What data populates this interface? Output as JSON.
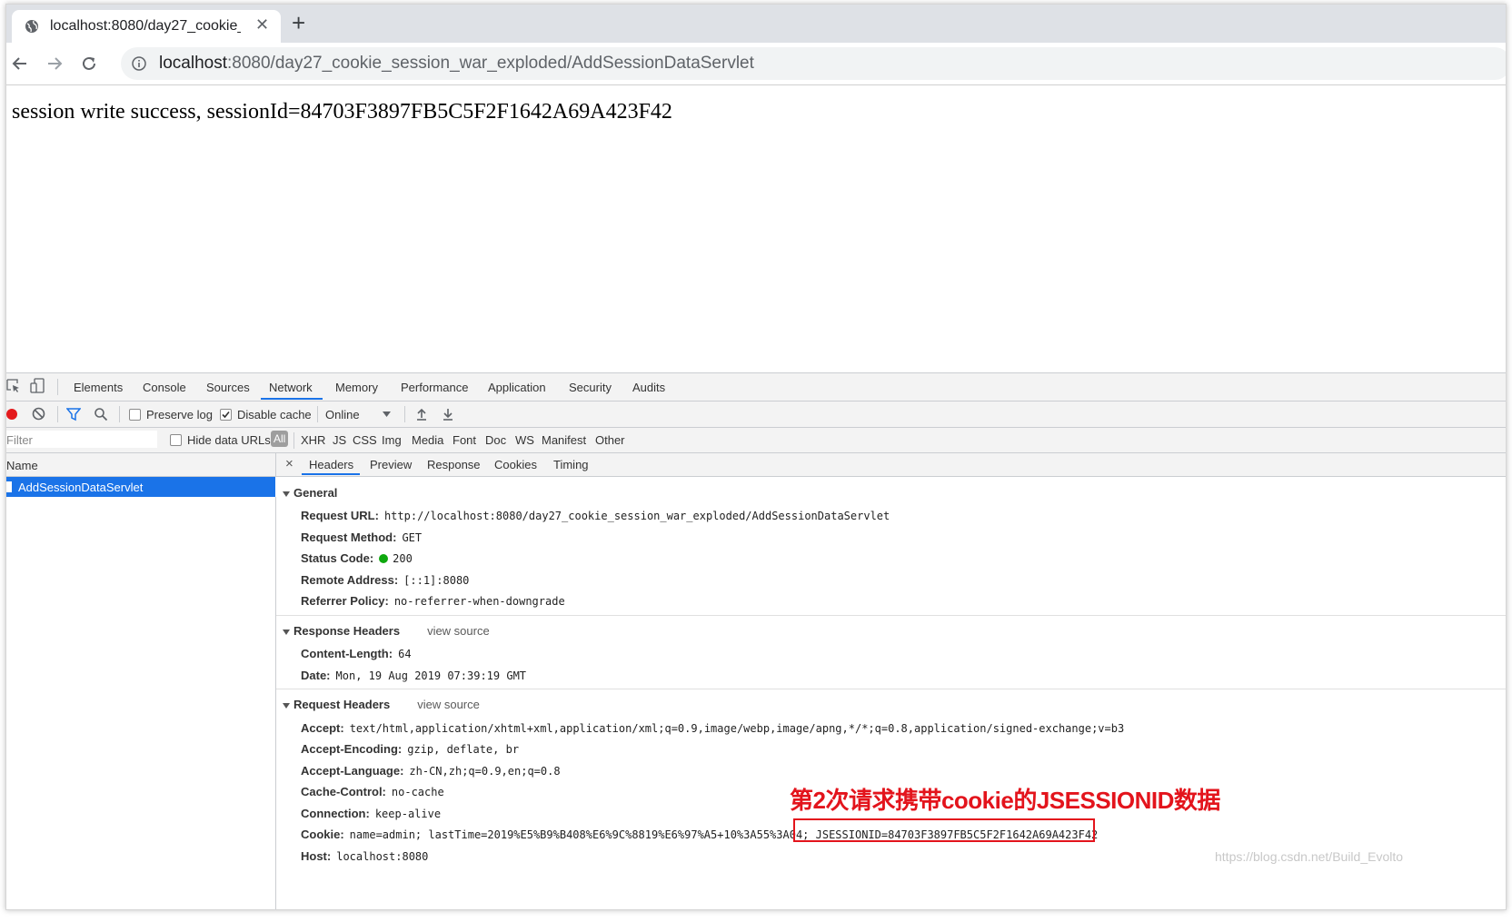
{
  "browser": {
    "tab_title": "localhost:8080/day27_cookie_s",
    "tab_close": "✕",
    "new_tab": "+",
    "url_host": "localhost",
    "url_rest": ":8080/day27_cookie_session_war_exploded/AddSessionDataServlet"
  },
  "page": {
    "message": "session write success, sessionId=84703F3897FB5C5F2F1642A69A423F42"
  },
  "devtools": {
    "tabs": [
      "Elements",
      "Console",
      "Sources",
      "Network",
      "Memory",
      "Performance",
      "Application",
      "Security",
      "Audits"
    ],
    "active_tab": "Network",
    "toolbar": {
      "preserve_log": "Preserve log",
      "disable_cache": "Disable cache",
      "disable_cache_checked": true,
      "throttle": "Online"
    },
    "filter": {
      "placeholder": "Filter",
      "hide_data_urls": "Hide data URLs",
      "types": [
        "All",
        "XHR",
        "JS",
        "CSS",
        "Img",
        "Media",
        "Font",
        "Doc",
        "WS",
        "Manifest",
        "Other"
      ]
    },
    "name_header": "Name",
    "request_name": "AddSessionDataServlet",
    "close_glyph": "×",
    "detail_tabs": [
      "Headers",
      "Preview",
      "Response",
      "Cookies",
      "Timing"
    ],
    "general": {
      "title": "General",
      "rows": [
        {
          "k": "Request URL:",
          "v": "http://localhost:8080/day27_cookie_session_war_exploded/AddSessionDataServlet"
        },
        {
          "k": "Request Method:",
          "v": "GET"
        },
        {
          "k": "Status Code:",
          "v": "200"
        },
        {
          "k": "Remote Address:",
          "v": "[::1]:8080"
        },
        {
          "k": "Referrer Policy:",
          "v": "no-referrer-when-downgrade"
        }
      ]
    },
    "response_headers": {
      "title": "Response Headers",
      "view_source": "view source",
      "rows": [
        {
          "k": "Content-Length:",
          "v": "64"
        },
        {
          "k": "Date:",
          "v": "Mon, 19 Aug 2019 07:39:19 GMT"
        }
      ]
    },
    "request_headers": {
      "title": "Request Headers",
      "view_source": "view source",
      "rows": [
        {
          "k": "Accept:",
          "v": "text/html,application/xhtml+xml,application/xml;q=0.9,image/webp,image/apng,*/*;q=0.8,application/signed-exchange;v=b3"
        },
        {
          "k": "Accept-Encoding:",
          "v": "gzip, deflate, br"
        },
        {
          "k": "Accept-Language:",
          "v": "zh-CN,zh;q=0.9,en;q=0.8"
        },
        {
          "k": "Cache-Control:",
          "v": "no-cache"
        },
        {
          "k": "Connection:",
          "v": "keep-alive"
        },
        {
          "k": "Cookie:",
          "v": "name=admin; lastTime=2019%E5%B9%B408%E6%9C%8819%E6%97%A5+10%3A55%3A04; JSESSIONID=84703F3897FB5C5F2F1642A69A423F42"
        },
        {
          "k": "Host:",
          "v": "localhost:8080"
        }
      ]
    }
  },
  "annotation": "第2次请求携带cookie的JSESSIONID数据",
  "watermark": "https://blog.csdn.net/Build_Evolto",
  "colors": {
    "accent": "#1a73e8",
    "annotation": "#e3141c",
    "status_ok": "#0ea80e"
  }
}
